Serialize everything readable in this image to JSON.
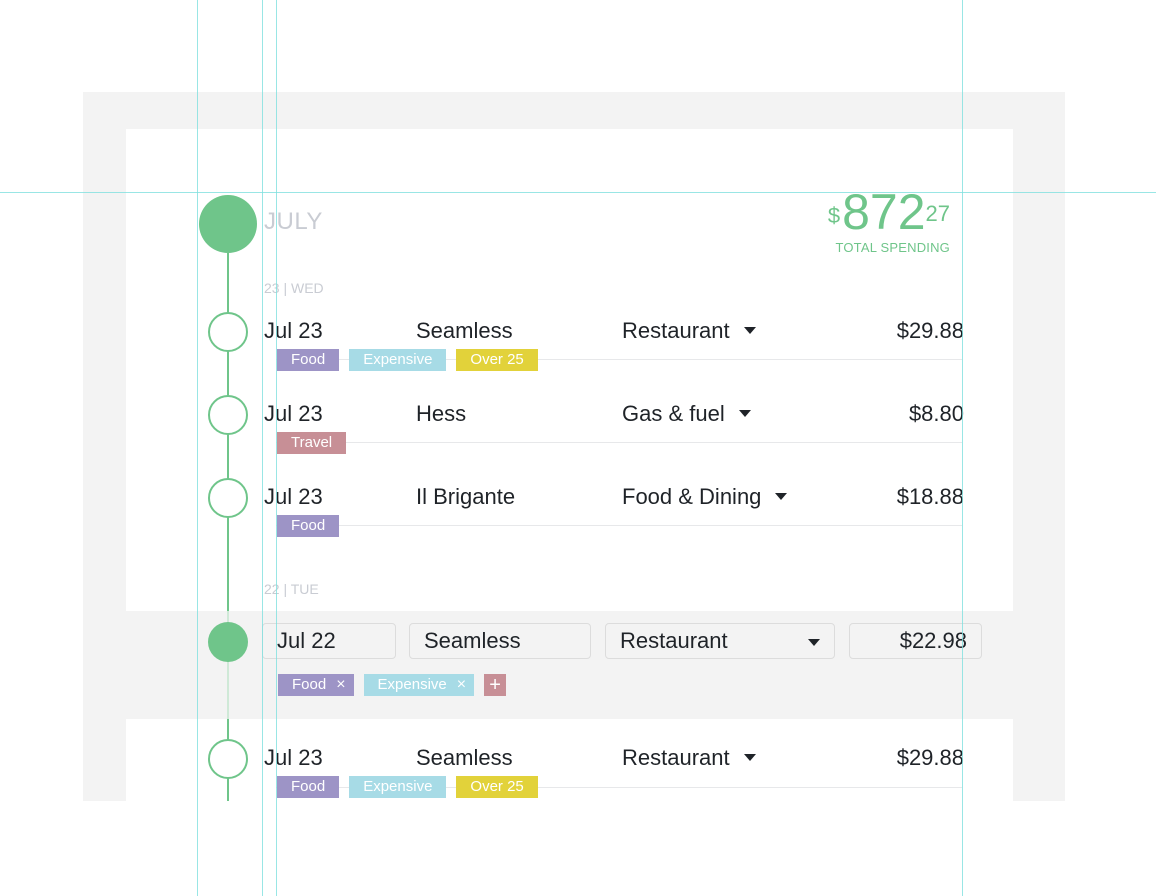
{
  "header": {
    "month": "JULY",
    "total": {
      "currency": "$",
      "whole": "872",
      "cents": "27",
      "label": "TOTAL SPENDING"
    }
  },
  "days": [
    {
      "label": "23 | WED"
    },
    {
      "label": "22 | TUE"
    }
  ],
  "transactions": [
    {
      "date": "Jul 23",
      "merchant": "Seamless",
      "category": "Restaurant",
      "amount": "$29.88",
      "tags": [
        {
          "label": "Food",
          "color": "#9d94c6"
        },
        {
          "label": "Expensive",
          "color": "#a7dbe6"
        },
        {
          "label": "Over 25",
          "color": "#e2d23a"
        }
      ]
    },
    {
      "date": "Jul 23",
      "merchant": "Hess",
      "category": "Gas & fuel",
      "amount": "$8.80",
      "tags": [
        {
          "label": "Travel",
          "color": "#c78f96"
        }
      ]
    },
    {
      "date": "Jul 23",
      "merchant": "Il Brigante",
      "category": "Food & Dining",
      "amount": "$18.88",
      "tags": [
        {
          "label": "Food",
          "color": "#9d94c6"
        }
      ]
    },
    {
      "date": "Jul 23",
      "merchant": "Seamless",
      "category": "Restaurant",
      "amount": "$29.88",
      "tags": [
        {
          "label": "Food",
          "color": "#9d94c6"
        },
        {
          "label": "Expensive",
          "color": "#a7dbe6"
        },
        {
          "label": "Over 25",
          "color": "#e2d23a"
        }
      ]
    }
  ],
  "editing": {
    "date": "Jul 22",
    "merchant": "Seamless",
    "category": "Restaurant",
    "amount": "$22.98",
    "tags": [
      {
        "label": "Food",
        "color": "#9d94c6"
      },
      {
        "label": "Expensive",
        "color": "#a7dbe6"
      }
    ],
    "remove_icon": "×",
    "add_icon": "+"
  },
  "colors": {
    "accent": "#6fc58a",
    "muted_text": "#c9ccd3",
    "guide": "#7fe0de"
  }
}
